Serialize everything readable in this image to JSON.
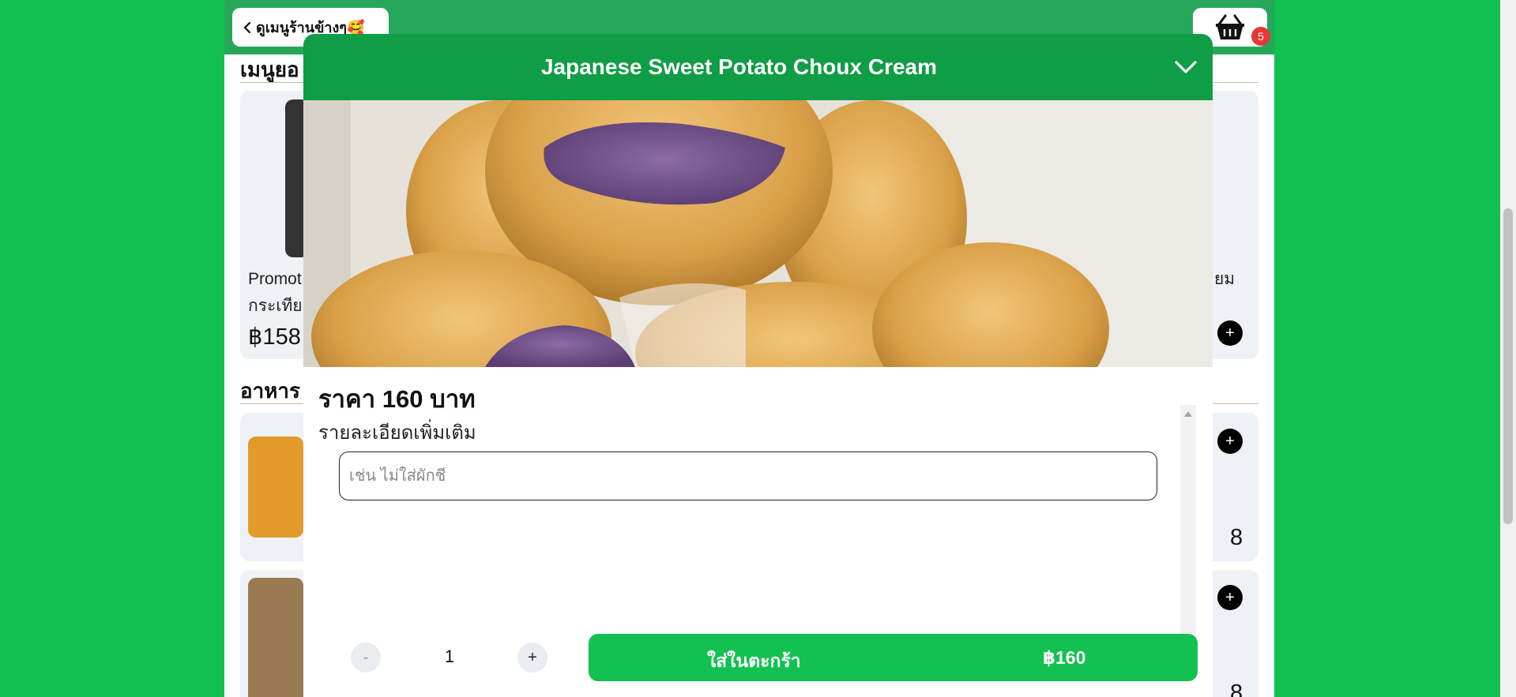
{
  "header": {
    "back_label": "ดูเมนูร้านข้างๆ🥰",
    "cart_count": "5"
  },
  "background": {
    "section_recommended": "เมนูยอ",
    "section_food": "อาหาร",
    "card1": {
      "name_line1": "Promot",
      "name_line2": "กระเทีย",
      "price": "฿158",
      "right_text": "ยม"
    },
    "card2": {
      "right_price": "8"
    },
    "card3": {
      "right_price": "8"
    },
    "plus_label": "+"
  },
  "modal": {
    "title": "Japanese Sweet Potato Choux Cream",
    "price_text": "ราคา 160 บาท",
    "details_label": "รายละเอียดเพิ่มเติม",
    "note_placeholder": "เช่น ไม่ใส่ผักชี",
    "note_value": "",
    "qty_minus": "-",
    "qty_plus": "+",
    "qty_value": "1",
    "add_to_cart_label": "ใส่ในตะกร้า",
    "add_to_cart_price": "฿160"
  },
  "colors": {
    "page_bg": "#12c152",
    "header_green": "#27a75a",
    "modal_header": "#0f9d45",
    "primary_button": "#12c152",
    "badge": "#e53935"
  },
  "icons": [
    "chevron-left-icon",
    "basket-icon",
    "chevron-down-icon",
    "plus-icon"
  ]
}
